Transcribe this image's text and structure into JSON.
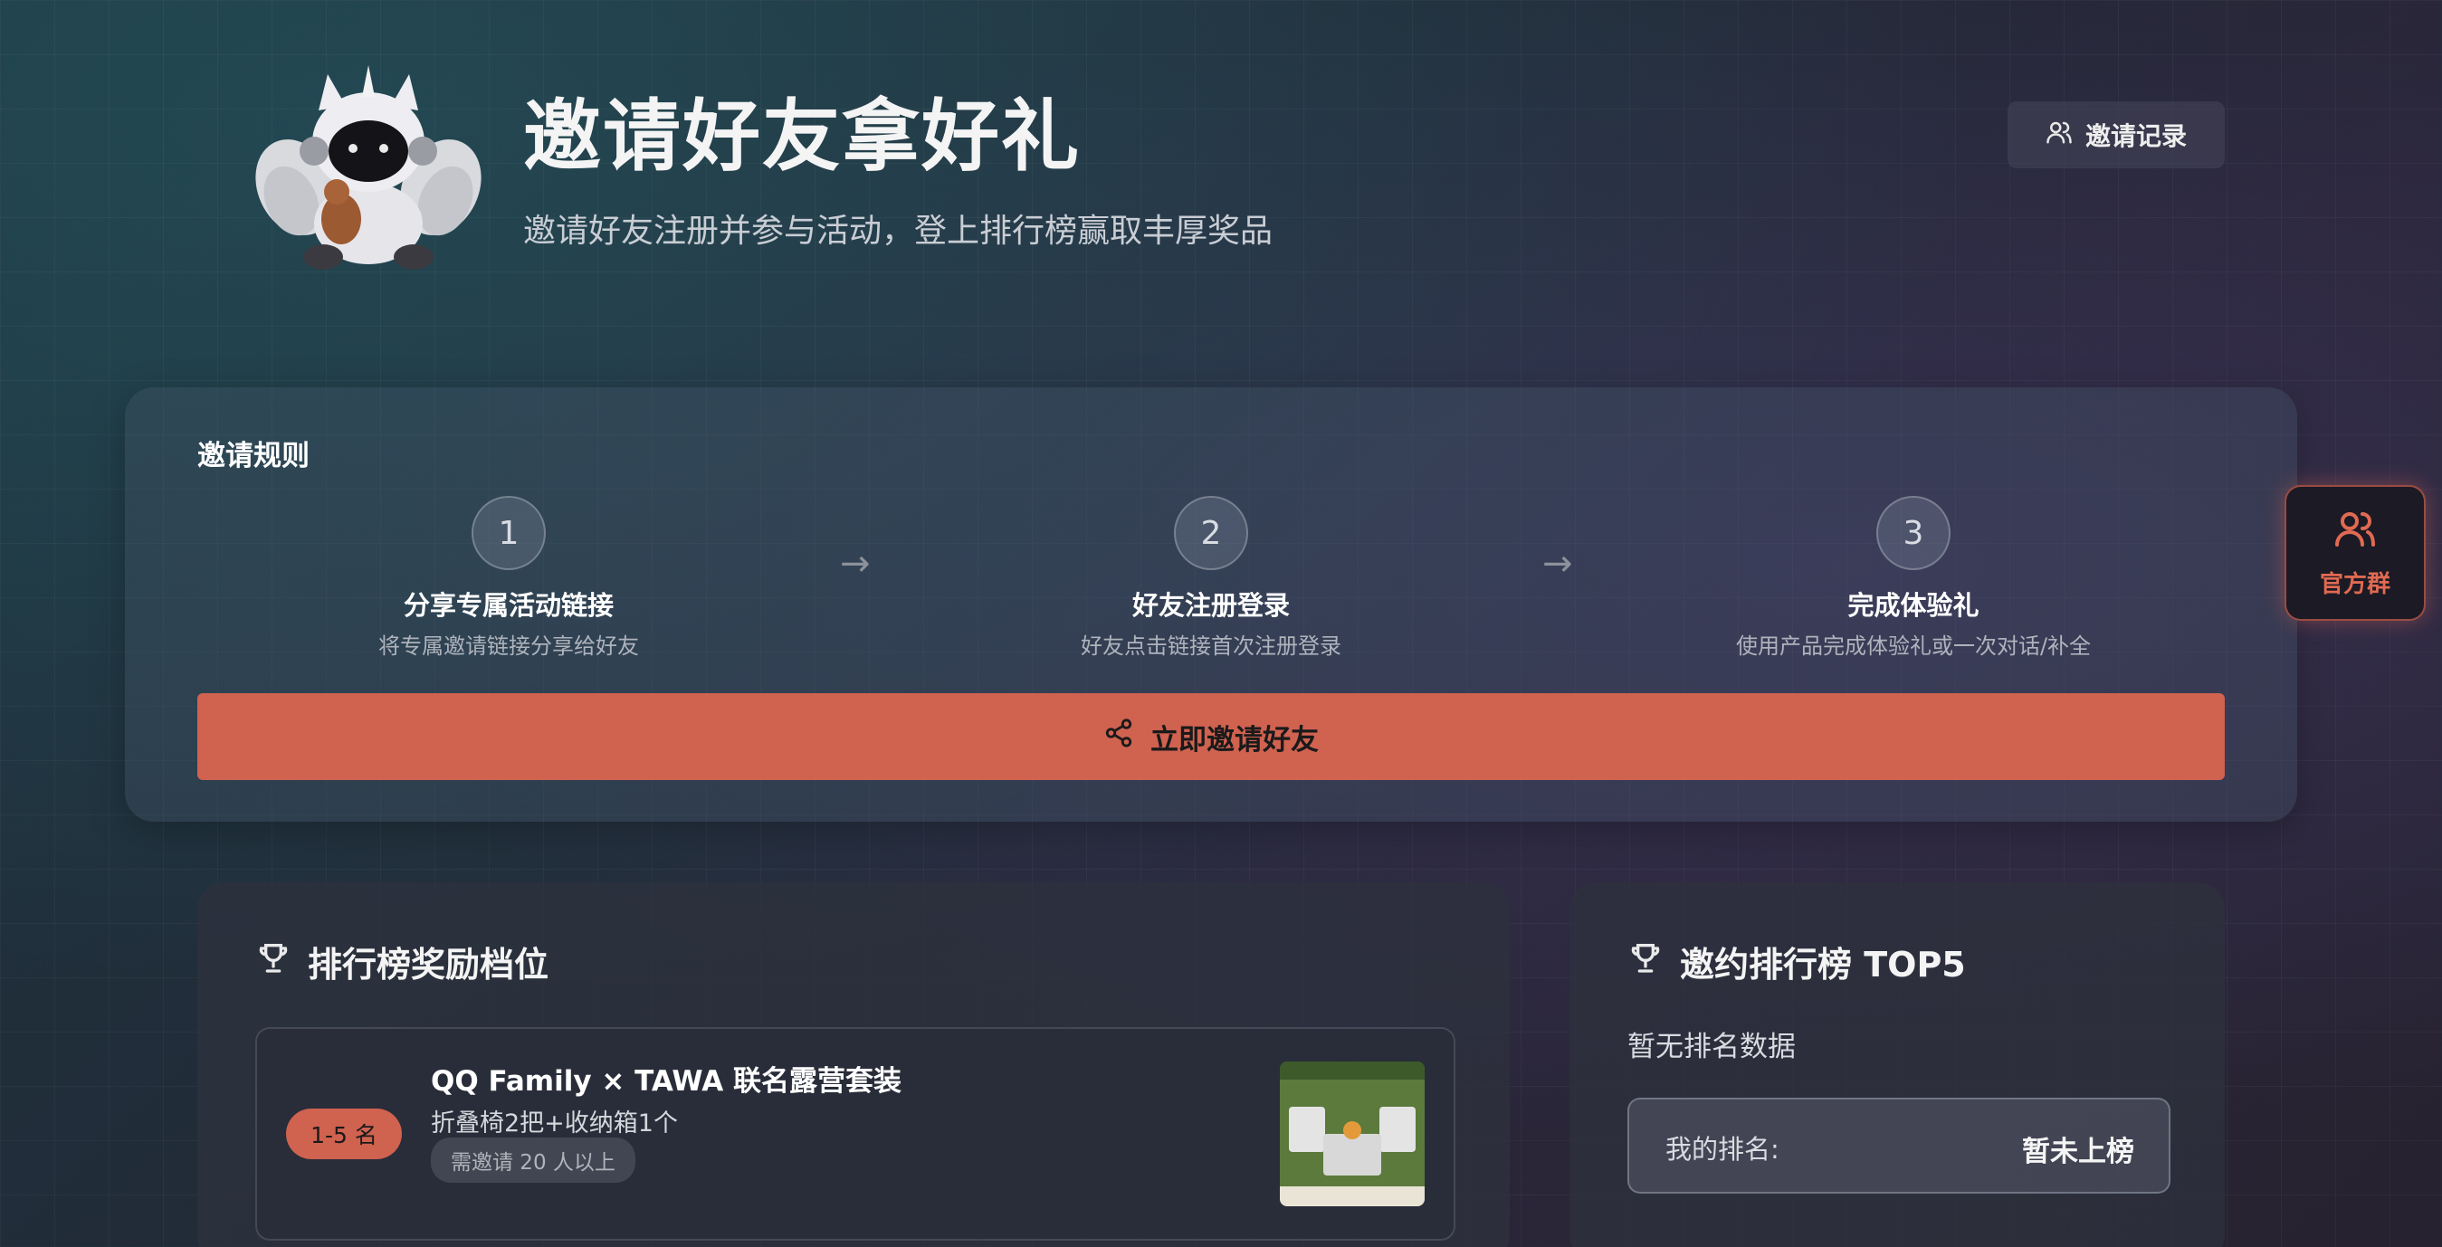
{
  "header": {
    "title": "邀请好友拿好礼",
    "subtitle": "邀请好友注册并参与活动，登上排行榜赢取丰厚奖品",
    "records_button": "邀请记录"
  },
  "rules": {
    "title": "邀请规则",
    "steps": [
      {
        "number": "1",
        "title": "分享专属活动链接",
        "desc": "将专属邀请链接分享给好友"
      },
      {
        "number": "2",
        "title": "好友注册登录",
        "desc": "好友点击链接首次注册登录"
      },
      {
        "number": "3",
        "title": "完成体验礼",
        "desc": "使用产品完成体验礼或一次对话/补全"
      }
    ],
    "arrow": "→",
    "invite_button": "立即邀请好友"
  },
  "floating": {
    "group_button": "官方群"
  },
  "rewards": {
    "title": "排行榜奖励档位",
    "items": [
      {
        "rank": "1-5 名",
        "name": "QQ Family × TAWA 联名露营套装",
        "desc": "折叠椅2把+收纳箱1个",
        "requirement": "需邀请 20 人以上"
      }
    ]
  },
  "ranking": {
    "title": "邀约排行榜 TOP5",
    "empty": "暂无排名数据",
    "my_rank_label": "我的排名:",
    "my_rank_value": "暂未上榜"
  },
  "colors": {
    "accent": "#d06250",
    "bg_dark": "#222b38"
  }
}
